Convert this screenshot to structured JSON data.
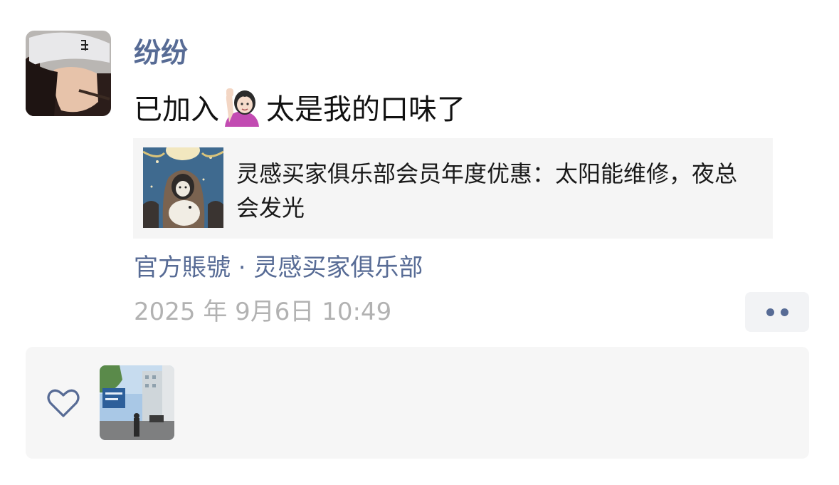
{
  "post": {
    "author": "纷纷",
    "text_before_emoji": "已加入",
    "emoji": "person-raising-hand-emoji",
    "text_after_emoji": "太是我的口味了",
    "link_card": {
      "title": "灵感买家俱乐部会员年度优惠：太阳能维修，夜总会发光"
    },
    "source": "官方賬號 · 灵感买家俱乐部",
    "timestamp": "2025 年 9月6日 10:49"
  },
  "likes": {
    "icon": "heart-outline-icon",
    "likers": [
      "liker-avatar"
    ]
  },
  "colors": {
    "link_blue": "#576b95",
    "timestamp_gray": "#b2b2b2",
    "panel_bg": "#f6f6f6"
  }
}
